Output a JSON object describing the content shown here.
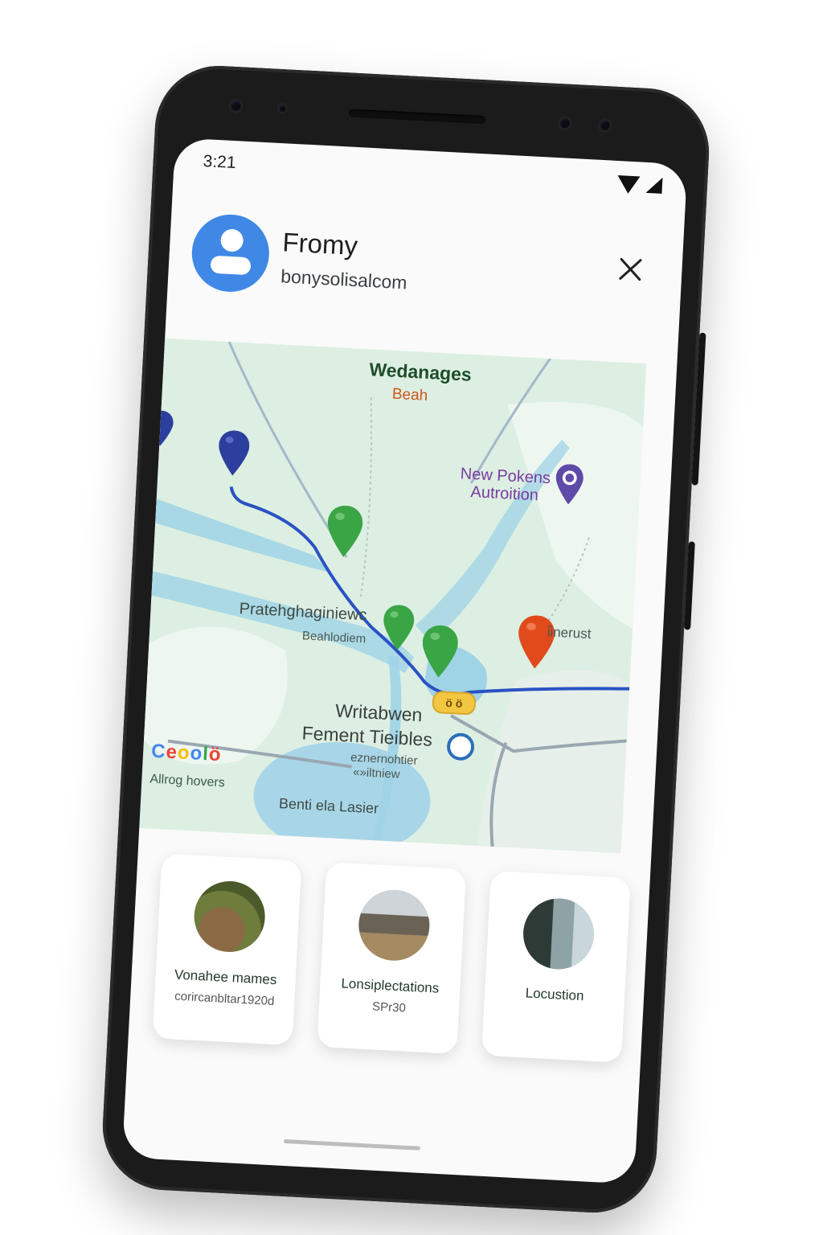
{
  "status_bar": {
    "time": "3:21"
  },
  "header": {
    "name": "Fromy",
    "email": "bonysolisalcom"
  },
  "map": {
    "labels": {
      "top_title": "Wedanages",
      "top_sub": "Beah",
      "poi_line1": "New Pokens",
      "poi_line2": "Autroition",
      "mid_title": "Pratehghaginiewc",
      "mid_sub": "Beahlodiem",
      "east": "ἵinerust",
      "lower_line1": "Writabwen",
      "lower_line2": "Fement Tieibles",
      "lower_small1": "eznernohtier",
      "lower_small2": "«»iltniew",
      "lake": "Benti ela Lasier",
      "corner": "Allrog hovers",
      "badge": "ö ö"
    },
    "logo_letters": [
      "C",
      "e",
      "o",
      "o",
      "l",
      "ö"
    ],
    "colors": {
      "water": "#9fd3e6",
      "land": "#dcefe2",
      "route": "#2a52c4",
      "pin_blue": "#2c3e9e",
      "pin_green": "#3aa544",
      "pin_red": "#e14a1b",
      "pin_purple": "#5e4aa8"
    }
  },
  "cards": [
    {
      "title": "Vonahee mames",
      "subtitle": "corircanbltar1920d"
    },
    {
      "title": "Lonsiplectations",
      "subtitle": "SPr30"
    },
    {
      "title": "Locustion",
      "subtitle": ""
    }
  ]
}
